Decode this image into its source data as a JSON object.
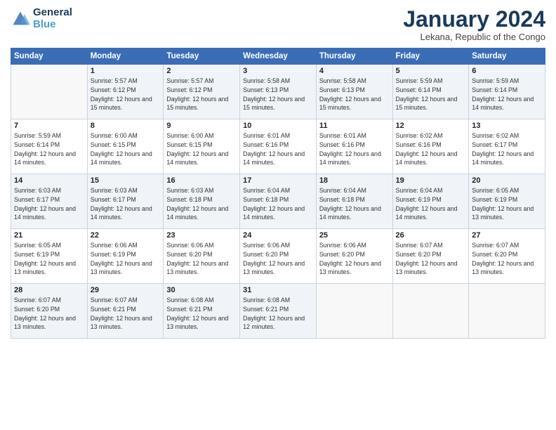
{
  "header": {
    "logo_general": "General",
    "logo_blue": "Blue",
    "month_title": "January 2024",
    "location": "Lekana, Republic of the Congo"
  },
  "days_of_week": [
    "Sunday",
    "Monday",
    "Tuesday",
    "Wednesday",
    "Thursday",
    "Friday",
    "Saturday"
  ],
  "weeks": [
    [
      {
        "num": "",
        "sunrise": "",
        "sunset": "",
        "daylight": ""
      },
      {
        "num": "1",
        "sunrise": "Sunrise: 5:57 AM",
        "sunset": "Sunset: 6:12 PM",
        "daylight": "Daylight: 12 hours and 15 minutes."
      },
      {
        "num": "2",
        "sunrise": "Sunrise: 5:57 AM",
        "sunset": "Sunset: 6:12 PM",
        "daylight": "Daylight: 12 hours and 15 minutes."
      },
      {
        "num": "3",
        "sunrise": "Sunrise: 5:58 AM",
        "sunset": "Sunset: 6:13 PM",
        "daylight": "Daylight: 12 hours and 15 minutes."
      },
      {
        "num": "4",
        "sunrise": "Sunrise: 5:58 AM",
        "sunset": "Sunset: 6:13 PM",
        "daylight": "Daylight: 12 hours and 15 minutes."
      },
      {
        "num": "5",
        "sunrise": "Sunrise: 5:59 AM",
        "sunset": "Sunset: 6:14 PM",
        "daylight": "Daylight: 12 hours and 15 minutes."
      },
      {
        "num": "6",
        "sunrise": "Sunrise: 5:59 AM",
        "sunset": "Sunset: 6:14 PM",
        "daylight": "Daylight: 12 hours and 14 minutes."
      }
    ],
    [
      {
        "num": "7",
        "sunrise": "Sunrise: 5:59 AM",
        "sunset": "Sunset: 6:14 PM",
        "daylight": "Daylight: 12 hours and 14 minutes."
      },
      {
        "num": "8",
        "sunrise": "Sunrise: 6:00 AM",
        "sunset": "Sunset: 6:15 PM",
        "daylight": "Daylight: 12 hours and 14 minutes."
      },
      {
        "num": "9",
        "sunrise": "Sunrise: 6:00 AM",
        "sunset": "Sunset: 6:15 PM",
        "daylight": "Daylight: 12 hours and 14 minutes."
      },
      {
        "num": "10",
        "sunrise": "Sunrise: 6:01 AM",
        "sunset": "Sunset: 6:16 PM",
        "daylight": "Daylight: 12 hours and 14 minutes."
      },
      {
        "num": "11",
        "sunrise": "Sunrise: 6:01 AM",
        "sunset": "Sunset: 6:16 PM",
        "daylight": "Daylight: 12 hours and 14 minutes."
      },
      {
        "num": "12",
        "sunrise": "Sunrise: 6:02 AM",
        "sunset": "Sunset: 6:16 PM",
        "daylight": "Daylight: 12 hours and 14 minutes."
      },
      {
        "num": "13",
        "sunrise": "Sunrise: 6:02 AM",
        "sunset": "Sunset: 6:17 PM",
        "daylight": "Daylight: 12 hours and 14 minutes."
      }
    ],
    [
      {
        "num": "14",
        "sunrise": "Sunrise: 6:03 AM",
        "sunset": "Sunset: 6:17 PM",
        "daylight": "Daylight: 12 hours and 14 minutes."
      },
      {
        "num": "15",
        "sunrise": "Sunrise: 6:03 AM",
        "sunset": "Sunset: 6:17 PM",
        "daylight": "Daylight: 12 hours and 14 minutes."
      },
      {
        "num": "16",
        "sunrise": "Sunrise: 6:03 AM",
        "sunset": "Sunset: 6:18 PM",
        "daylight": "Daylight: 12 hours and 14 minutes."
      },
      {
        "num": "17",
        "sunrise": "Sunrise: 6:04 AM",
        "sunset": "Sunset: 6:18 PM",
        "daylight": "Daylight: 12 hours and 14 minutes."
      },
      {
        "num": "18",
        "sunrise": "Sunrise: 6:04 AM",
        "sunset": "Sunset: 6:18 PM",
        "daylight": "Daylight: 12 hours and 14 minutes."
      },
      {
        "num": "19",
        "sunrise": "Sunrise: 6:04 AM",
        "sunset": "Sunset: 6:19 PM",
        "daylight": "Daylight: 12 hours and 14 minutes."
      },
      {
        "num": "20",
        "sunrise": "Sunrise: 6:05 AM",
        "sunset": "Sunset: 6:19 PM",
        "daylight": "Daylight: 12 hours and 13 minutes."
      }
    ],
    [
      {
        "num": "21",
        "sunrise": "Sunrise: 6:05 AM",
        "sunset": "Sunset: 6:19 PM",
        "daylight": "Daylight: 12 hours and 13 minutes."
      },
      {
        "num": "22",
        "sunrise": "Sunrise: 6:06 AM",
        "sunset": "Sunset: 6:19 PM",
        "daylight": "Daylight: 12 hours and 13 minutes."
      },
      {
        "num": "23",
        "sunrise": "Sunrise: 6:06 AM",
        "sunset": "Sunset: 6:20 PM",
        "daylight": "Daylight: 12 hours and 13 minutes."
      },
      {
        "num": "24",
        "sunrise": "Sunrise: 6:06 AM",
        "sunset": "Sunset: 6:20 PM",
        "daylight": "Daylight: 12 hours and 13 minutes."
      },
      {
        "num": "25",
        "sunrise": "Sunrise: 6:06 AM",
        "sunset": "Sunset: 6:20 PM",
        "daylight": "Daylight: 12 hours and 13 minutes."
      },
      {
        "num": "26",
        "sunrise": "Sunrise: 6:07 AM",
        "sunset": "Sunset: 6:20 PM",
        "daylight": "Daylight: 12 hours and 13 minutes."
      },
      {
        "num": "27",
        "sunrise": "Sunrise: 6:07 AM",
        "sunset": "Sunset: 6:20 PM",
        "daylight": "Daylight: 12 hours and 13 minutes."
      }
    ],
    [
      {
        "num": "28",
        "sunrise": "Sunrise: 6:07 AM",
        "sunset": "Sunset: 6:20 PM",
        "daylight": "Daylight: 12 hours and 13 minutes."
      },
      {
        "num": "29",
        "sunrise": "Sunrise: 6:07 AM",
        "sunset": "Sunset: 6:21 PM",
        "daylight": "Daylight: 12 hours and 13 minutes."
      },
      {
        "num": "30",
        "sunrise": "Sunrise: 6:08 AM",
        "sunset": "Sunset: 6:21 PM",
        "daylight": "Daylight: 12 hours and 13 minutes."
      },
      {
        "num": "31",
        "sunrise": "Sunrise: 6:08 AM",
        "sunset": "Sunset: 6:21 PM",
        "daylight": "Daylight: 12 hours and 12 minutes."
      },
      {
        "num": "",
        "sunrise": "",
        "sunset": "",
        "daylight": ""
      },
      {
        "num": "",
        "sunrise": "",
        "sunset": "",
        "daylight": ""
      },
      {
        "num": "",
        "sunrise": "",
        "sunset": "",
        "daylight": ""
      }
    ]
  ]
}
